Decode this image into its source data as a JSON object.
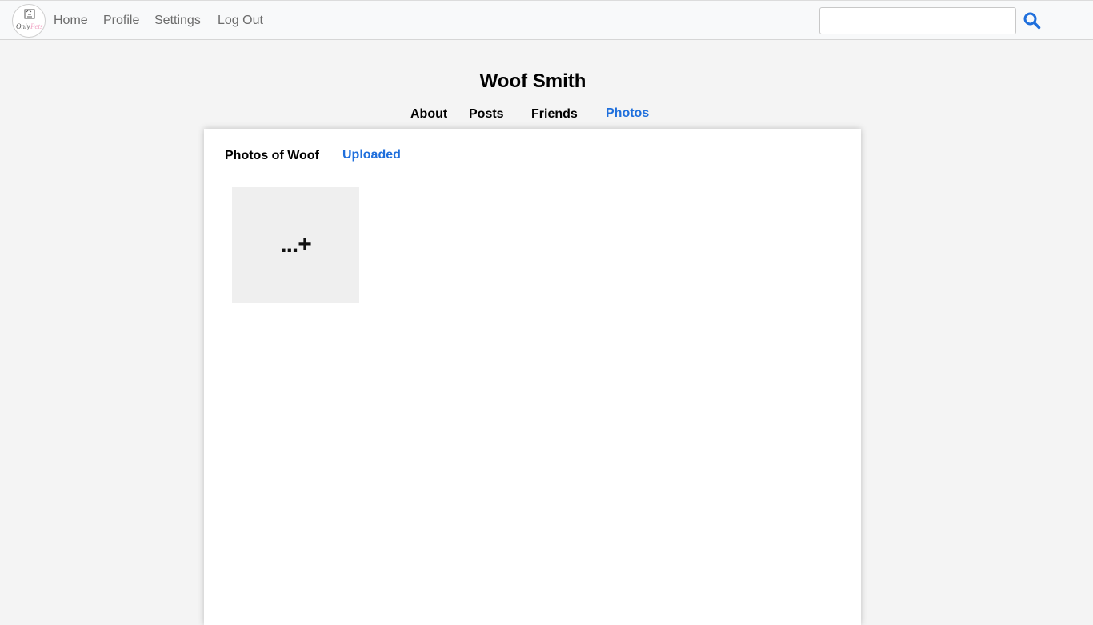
{
  "nav": {
    "home": "Home",
    "profile": "Profile",
    "settings": "Settings",
    "logout": "Log Out",
    "logo_text": "OnlyPets",
    "search_value": "",
    "search_icon": "search-icon"
  },
  "profile": {
    "name": "Woof Smith",
    "tabs": [
      {
        "label": "About",
        "active": false
      },
      {
        "label": "Posts",
        "active": false
      },
      {
        "label": "Friends",
        "active": false
      },
      {
        "label": "Photos",
        "active": true
      }
    ]
  },
  "photos": {
    "subtabs": [
      {
        "label": "Photos of Woof",
        "active": false
      },
      {
        "label": "Uploaded",
        "active": true
      }
    ],
    "add_tile_label": "...+"
  },
  "colors": {
    "accent": "#1f6fdc",
    "background": "#f4f4f4",
    "navbar": "#f8f9fa",
    "tile": "#efefef"
  }
}
